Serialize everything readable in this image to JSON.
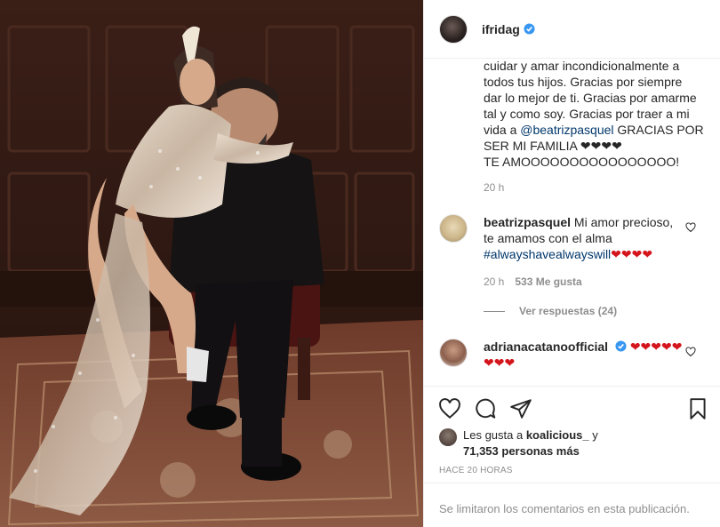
{
  "post": {
    "username": "ifridag",
    "caption_lines": [
      "cuidar y amar incondicionalmente a",
      "todos tus hijos. Gracias por siempre",
      "dar lo mejor de ti. Gracias por amarme",
      "tal y como soy. Gracias por traer a mi"
    ],
    "caption_line5_pre": "vida a ",
    "caption_mention": "@beatrizpasquel",
    "caption_line5_post": " GRACIAS POR",
    "caption_line6": "SER MI FAMILIA ❤❤❤❤",
    "caption_line7": "TE AMOOOOOOOOOOOOOOOO!",
    "caption_time": "20 h"
  },
  "comments": [
    {
      "username": "beatrizpasquel",
      "text_line1": "Mi amor precioso,",
      "text_line2": "te amamos con el alma",
      "hashtag": "#alwayshavealwayswill",
      "hearts": "❤❤❤❤",
      "time": "20 h",
      "likes": "533 Me gusta",
      "replies": "Ver respuestas (24)"
    },
    {
      "username": "adrianacatanoofficial",
      "text_line1": "❤❤❤❤❤",
      "text_line2": "❤❤❤"
    }
  ],
  "likes": {
    "prefix": "Les gusta a ",
    "user": "koalicious_",
    "mid": " y",
    "count": "71,353 personas más"
  },
  "posted_time": "HACE 20 HORAS",
  "comments_limited": "Se limitaron los comentarios en esta publicación.",
  "colors": {
    "verified": "#3897f0",
    "link": "#00376b",
    "muted": "#8e8e8e",
    "heart": "#d4151c"
  },
  "icons": [
    "verified-icon",
    "heart-icon",
    "comment-icon",
    "share-icon",
    "bookmark-icon"
  ]
}
